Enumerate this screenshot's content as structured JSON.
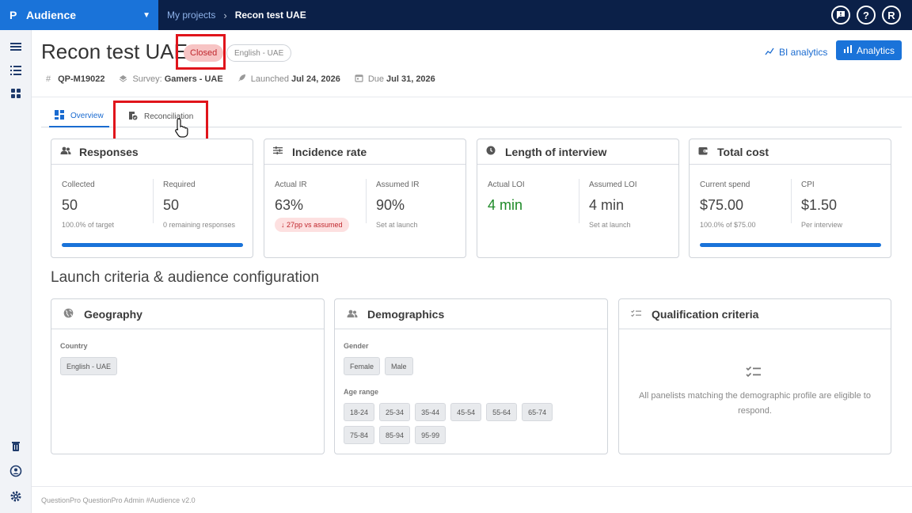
{
  "app": {
    "name": "Audience",
    "logo": "P"
  },
  "breadcrumb": {
    "parent": "My projects",
    "separator": "›",
    "current": "Recon test UAE"
  },
  "top_icons": [
    "feedback-icon",
    "help-icon",
    "avatar"
  ],
  "user": {
    "initial": "R"
  },
  "rail_icons": [
    "menu-icon",
    "list-icon",
    "dashboard-icon",
    "trash-icon",
    "user-shield-icon",
    "settings-icon"
  ],
  "project": {
    "title": "Recon test UAE",
    "status": "Closed",
    "language": "English - UAE",
    "meta": {
      "id": "QP-M19022",
      "survey_label": "Survey:",
      "survey": "Gamers - UAE",
      "launched_label": "Launched",
      "launched": "Jul 24, 2026",
      "due_label": "Due",
      "due": "Jul 31, 2026"
    }
  },
  "header_actions": {
    "bi_label": "BI analytics",
    "analytics_label": "Analytics"
  },
  "tabs": [
    {
      "label": "Overview",
      "active": true
    },
    {
      "label": "Reconciliation",
      "active": false
    }
  ],
  "cards": {
    "responses": {
      "title": "Responses",
      "left": {
        "label": "Collected",
        "value": "50",
        "sub": "100.0% of target"
      },
      "right": {
        "label": "Required",
        "value": "50",
        "sub": "0 remaining responses"
      },
      "progress": 1.0
    },
    "incidence": {
      "title": "Incidence rate",
      "left": {
        "label": "Actual IR",
        "value": "63%",
        "pill": "↓ 27pp vs assumed"
      },
      "right": {
        "label": "Assumed IR",
        "value": "90%",
        "sub": "Set at launch"
      }
    },
    "loi": {
      "title": "Length of interview",
      "left": {
        "label": "Actual LOI",
        "value": "4 min"
      },
      "right": {
        "label": "Assumed LOI",
        "value": "4 min",
        "sub": "Set at launch"
      }
    },
    "cost": {
      "title": "Total cost",
      "left": {
        "label": "Current spend",
        "value": "$75.00",
        "sub": "100.0% of $75.00"
      },
      "right": {
        "label": "CPI",
        "value": "$1.50",
        "sub": "Per interview"
      },
      "progress": 1.0
    }
  },
  "section_title": "Launch criteria & audience configuration",
  "geography": {
    "title": "Geography",
    "country_label": "Country",
    "countries": [
      "English - UAE"
    ]
  },
  "demographics": {
    "title": "Demographics",
    "gender_label": "Gender",
    "genders": [
      "Female",
      "Male"
    ],
    "age_label": "Age range",
    "ages": [
      "18-24",
      "25-34",
      "35-44",
      "45-54",
      "55-64",
      "65-74",
      "75-84",
      "85-94",
      "95-99"
    ]
  },
  "qualification": {
    "title": "Qualification criteria",
    "empty_text": "All panelists matching the demographic profile are eligible to respond."
  },
  "footer": "QuestionPro QuestionPro Admin  #Audience v2.0",
  "colors": {
    "brand": "#1a73d9",
    "topbar": "#0b2048",
    "closed_badge": "#f7c4c4",
    "highlight": "#e0141b",
    "positive": "#1e8a28"
  }
}
